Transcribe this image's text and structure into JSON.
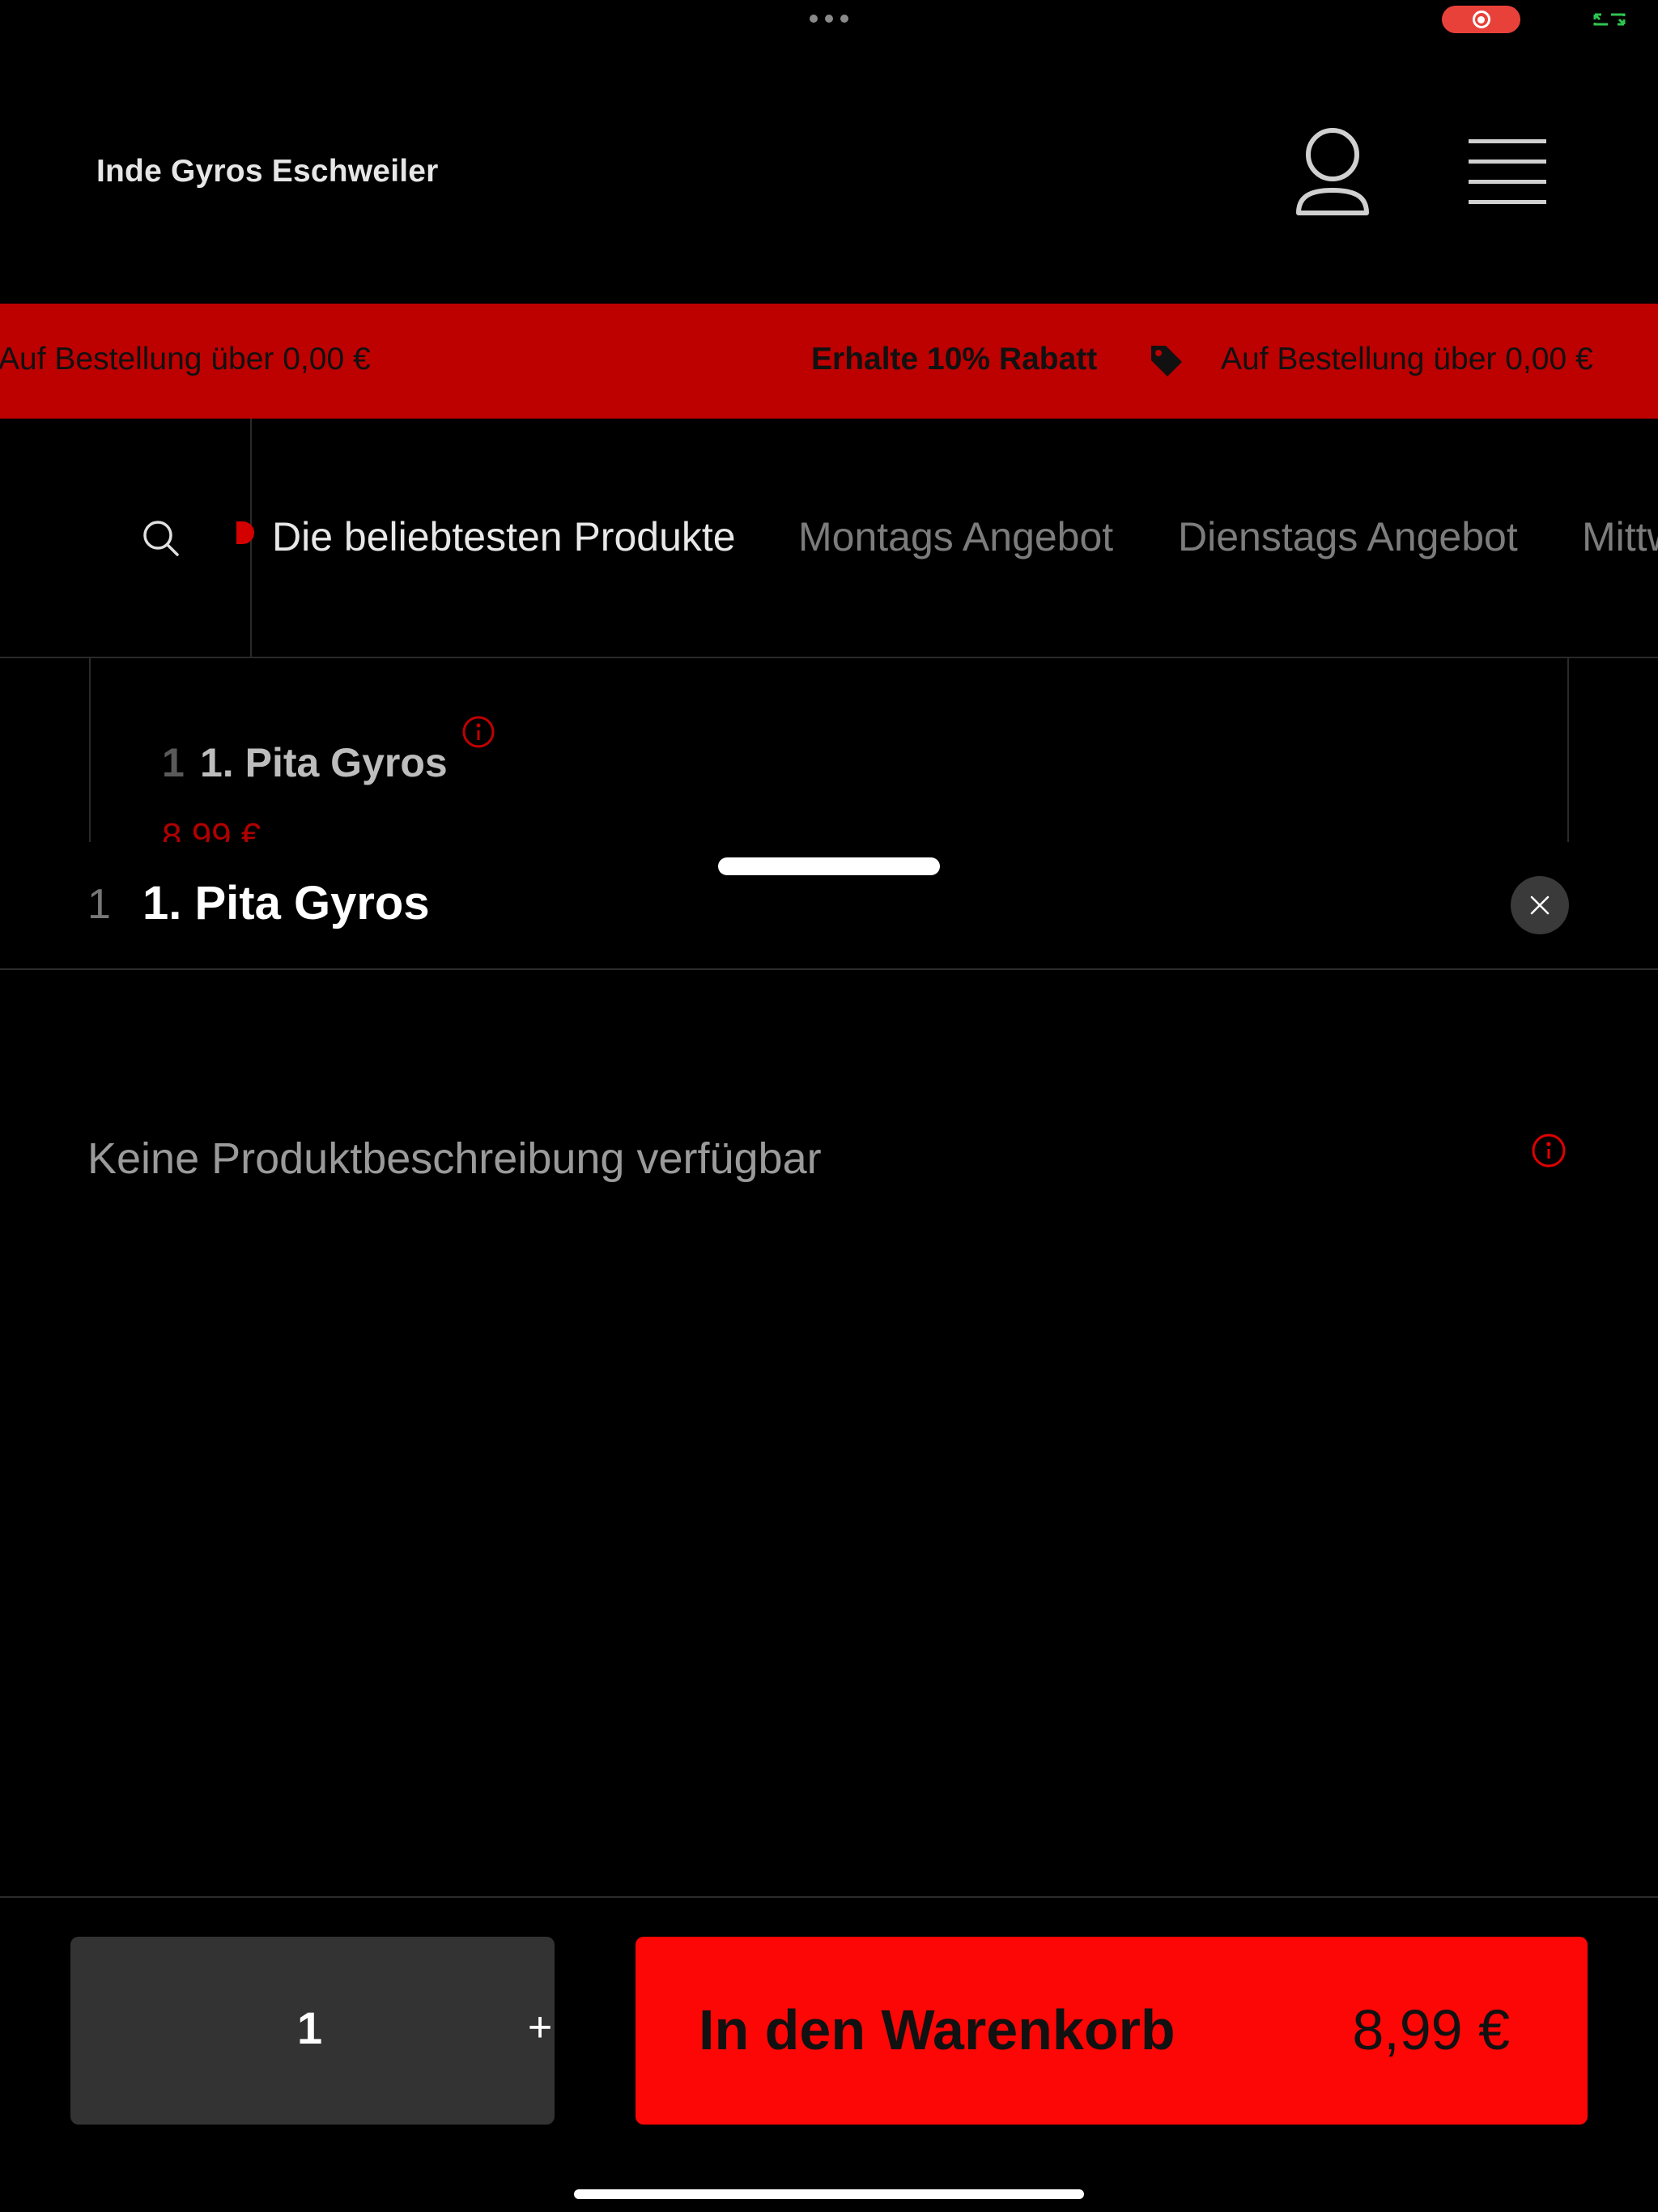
{
  "header": {
    "store_name": "Inde Gyros Eschweiler",
    "icons": [
      "user-icon",
      "hamburger-menu-icon"
    ]
  },
  "status": {
    "recording_color": "#e8413a",
    "screen_indicator_color": "#2fc34f"
  },
  "promo_banner": {
    "color": "#bd0000",
    "items": [
      "Auf Bestellung über 0,00 €",
      "Erhalte 10% Rabatt",
      "Auf Bestellung über 0,00 €"
    ]
  },
  "category_nav": {
    "tabs": [
      {
        "label": "Die beliebtesten Produkte",
        "active": true
      },
      {
        "label": "Montags Angebot",
        "active": false
      },
      {
        "label": "Dienstags Angebot",
        "active": false
      },
      {
        "label": "Mittw",
        "active": false
      }
    ]
  },
  "background_product": {
    "number": "1",
    "name": "1. Pita Gyros",
    "price": "8,99 €"
  },
  "product_sheet": {
    "number": "1",
    "title": "1. Pita Gyros",
    "description": "Keine Produktbeschreibung verfügbar",
    "quantity": "1",
    "plus_label": "+",
    "add_to_cart_label": "In den Warenkorb",
    "price": "8,99 €",
    "accent_color": "#fc0606"
  }
}
